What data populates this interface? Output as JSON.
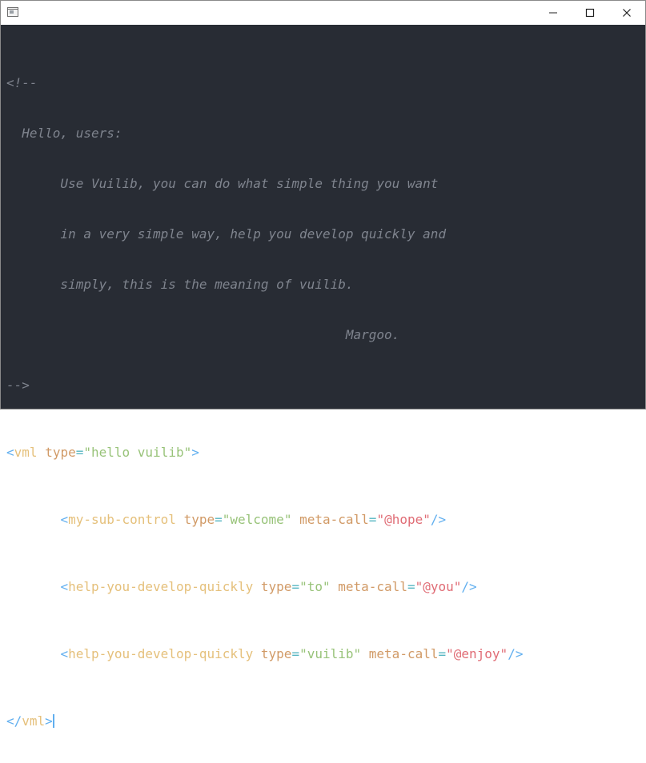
{
  "window": {
    "icon": "app-window-icon",
    "controls": {
      "minimize": "minimize-icon",
      "maximize": "maximize-icon",
      "close": "close-icon"
    }
  },
  "editor": {
    "comment_lines": [
      "<!--",
      "  Hello, users:",
      "       Use Vuilib, you can do what simple thing you want",
      "       in a very simple way, help you develop quickly and",
      "       simply, this is the meaning of vuilib.",
      "                                            Margoo.",
      "-->"
    ],
    "root_open": {
      "lt": "<",
      "tag": "vml",
      "attr": "type",
      "eq": "=",
      "value": "\"hello vuilib\"",
      "gt": ">"
    },
    "children": [
      {
        "indent": "       ",
        "lt": "<",
        "tag": "my-sub-control",
        "attr1": "type",
        "value1": "\"welcome\"",
        "attr2": "meta-call",
        "value2": "\"@hope\"",
        "end": "/>"
      },
      {
        "indent": "       ",
        "lt": "<",
        "tag": "help-you-develop-quickly",
        "attr1": "type",
        "value1": "\"to\"",
        "attr2": "meta-call",
        "value2": "\"@you\"",
        "end": "/>"
      },
      {
        "indent": "       ",
        "lt": "<",
        "tag": "help-you-develop-quickly",
        "attr1": "type",
        "value1": "\"vuilib\"",
        "attr2": "meta-call",
        "value2": "\"@enjoy\"",
        "end": "/>"
      }
    ],
    "root_close": {
      "lt": "</",
      "tag": "vml",
      "gt": ">"
    },
    "colors": {
      "background": "#282c34",
      "comment": "#7f848e",
      "punctuation": "#61afef",
      "tag": "#e5c07b",
      "attribute": "#d19a66",
      "string": "#98c379",
      "meta_string": "#e06c75"
    }
  }
}
